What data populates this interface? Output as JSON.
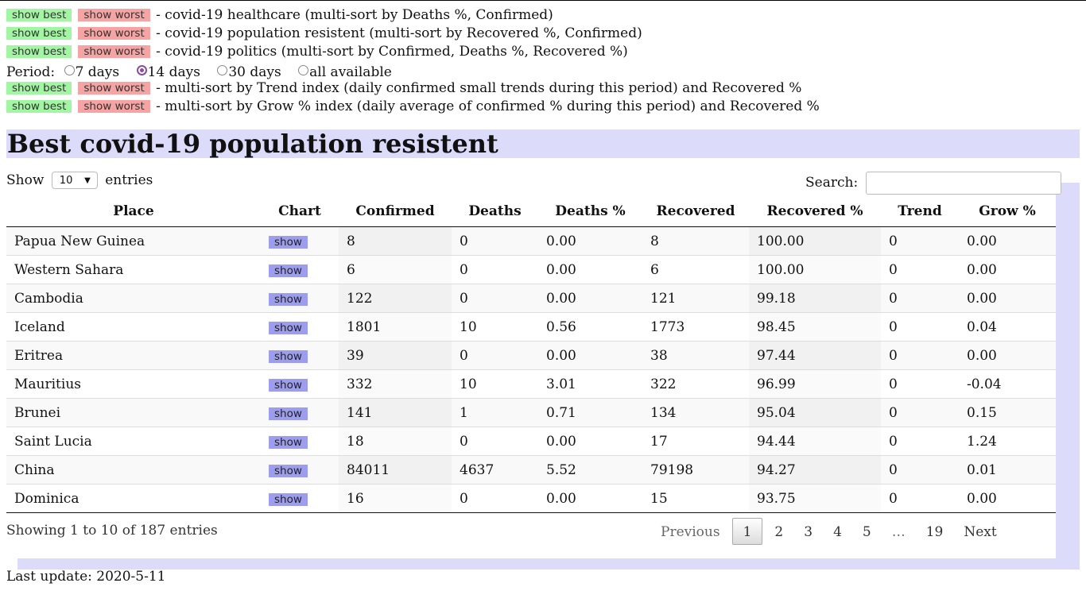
{
  "sort_rows": [
    {
      "best": "show best",
      "worst": "show worst",
      "desc": "- covid-19 healthcare (multi-sort by Deaths %, Confirmed)"
    },
    {
      "best": "show best",
      "worst": "show worst",
      "desc": "- covid-19 population resistent (multi-sort by Recovered %, Confirmed)"
    },
    {
      "best": "show best",
      "worst": "show worst",
      "desc": "- covid-19 politics (multi-sort by Confirmed, Deaths %, Recovered %)"
    }
  ],
  "period": {
    "label": "Period:",
    "options": [
      {
        "label": "7 days",
        "selected": false
      },
      {
        "label": "14 days",
        "selected": true
      },
      {
        "label": "30 days",
        "selected": false
      },
      {
        "label": "all available",
        "selected": false
      }
    ]
  },
  "index_rows": [
    {
      "best": "show best",
      "worst": "show worst",
      "desc": "- multi-sort by Trend index (daily confirmed small trends during this period) and Recovered %"
    },
    {
      "best": "show best",
      "worst": "show worst",
      "desc": "- multi-sort by Grow % index (daily average of confirmed % during this period) and Recovered %"
    }
  ],
  "heading": "Best covid-19 population resistent",
  "length": {
    "show": "Show",
    "value": "10",
    "entries": "entries"
  },
  "search": {
    "label": "Search:",
    "value": ""
  },
  "table": {
    "columns": [
      "Place",
      "Chart",
      "Confirmed",
      "Deaths",
      "Deaths %",
      "Recovered",
      "Recovered %",
      "Trend",
      "Grow %"
    ],
    "rows": [
      {
        "place": "Papua New Guinea",
        "chart": "show",
        "confirmed": "8",
        "deaths": "0",
        "deaths_pct": "0.00",
        "recovered": "8",
        "recovered_pct": "100.00",
        "trend": "0",
        "grow": "0.00"
      },
      {
        "place": "Western Sahara",
        "chart": "show",
        "confirmed": "6",
        "deaths": "0",
        "deaths_pct": "0.00",
        "recovered": "6",
        "recovered_pct": "100.00",
        "trend": "0",
        "grow": "0.00"
      },
      {
        "place": "Cambodia",
        "chart": "show",
        "confirmed": "122",
        "deaths": "0",
        "deaths_pct": "0.00",
        "recovered": "121",
        "recovered_pct": "99.18",
        "trend": "0",
        "grow": "0.00"
      },
      {
        "place": "Iceland",
        "chart": "show",
        "confirmed": "1801",
        "deaths": "10",
        "deaths_pct": "0.56",
        "recovered": "1773",
        "recovered_pct": "98.45",
        "trend": "0",
        "grow": "0.04"
      },
      {
        "place": "Eritrea",
        "chart": "show",
        "confirmed": "39",
        "deaths": "0",
        "deaths_pct": "0.00",
        "recovered": "38",
        "recovered_pct": "97.44",
        "trend": "0",
        "grow": "0.00"
      },
      {
        "place": "Mauritius",
        "chart": "show",
        "confirmed": "332",
        "deaths": "10",
        "deaths_pct": "3.01",
        "recovered": "322",
        "recovered_pct": "96.99",
        "trend": "0",
        "grow": "-0.04"
      },
      {
        "place": "Brunei",
        "chart": "show",
        "confirmed": "141",
        "deaths": "1",
        "deaths_pct": "0.71",
        "recovered": "134",
        "recovered_pct": "95.04",
        "trend": "0",
        "grow": "0.15"
      },
      {
        "place": "Saint Lucia",
        "chart": "show",
        "confirmed": "18",
        "deaths": "0",
        "deaths_pct": "0.00",
        "recovered": "17",
        "recovered_pct": "94.44",
        "trend": "0",
        "grow": "1.24"
      },
      {
        "place": "China",
        "chart": "show",
        "confirmed": "84011",
        "deaths": "4637",
        "deaths_pct": "5.52",
        "recovered": "79198",
        "recovered_pct": "94.27",
        "trend": "0",
        "grow": "0.01"
      },
      {
        "place": "Dominica",
        "chart": "show",
        "confirmed": "16",
        "deaths": "0",
        "deaths_pct": "0.00",
        "recovered": "15",
        "recovered_pct": "93.75",
        "trend": "0",
        "grow": "0.00"
      }
    ]
  },
  "info": "Showing 1 to 10 of 187 entries",
  "pagination": {
    "previous": "Previous",
    "pages": [
      "1",
      "2",
      "3",
      "4",
      "5",
      "…",
      "19"
    ],
    "current": "1",
    "next": "Next"
  },
  "last_update": "Last update: 2020-5-11",
  "colors": {
    "best": "#a2f5a2",
    "worst": "#f5a3a3",
    "chart_button": "#9d9df0",
    "heading_band": "#dcdcfa",
    "radio_selected": "#8a4d9a"
  }
}
